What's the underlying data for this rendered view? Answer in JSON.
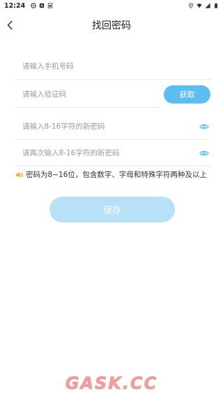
{
  "status_bar": {
    "time": "12:24",
    "left_icons": [
      "pinwheel-icon",
      "app-icon",
      "sim-icon"
    ],
    "right_icons": [
      "location-icon",
      "wifi-icon",
      "signal-icon",
      "battery-icon"
    ]
  },
  "nav": {
    "title": "找回密码",
    "back_icon": "chevron-left-icon"
  },
  "form": {
    "phone_placeholder": "请输入手机号码",
    "code_placeholder": "请输入验证码",
    "get_code_label": "获取",
    "new_password_placeholder": "请输入8-16字符的新密码",
    "confirm_password_placeholder": "请再次输入8-16字符的新密码",
    "eye_icon": "eye-icon"
  },
  "hint": {
    "icon": "speaker-icon",
    "text": "密码为8~16位，包含数字、字母和特殊字符两种及以上"
  },
  "save_label": "保存",
  "watermark": {
    "text": "GASK.CC"
  },
  "colors": {
    "accent": "#5cbdf0",
    "save_disabled": "#b8e1f8",
    "hint_icon": "#f5a623",
    "watermark": "#f0a0a0"
  }
}
